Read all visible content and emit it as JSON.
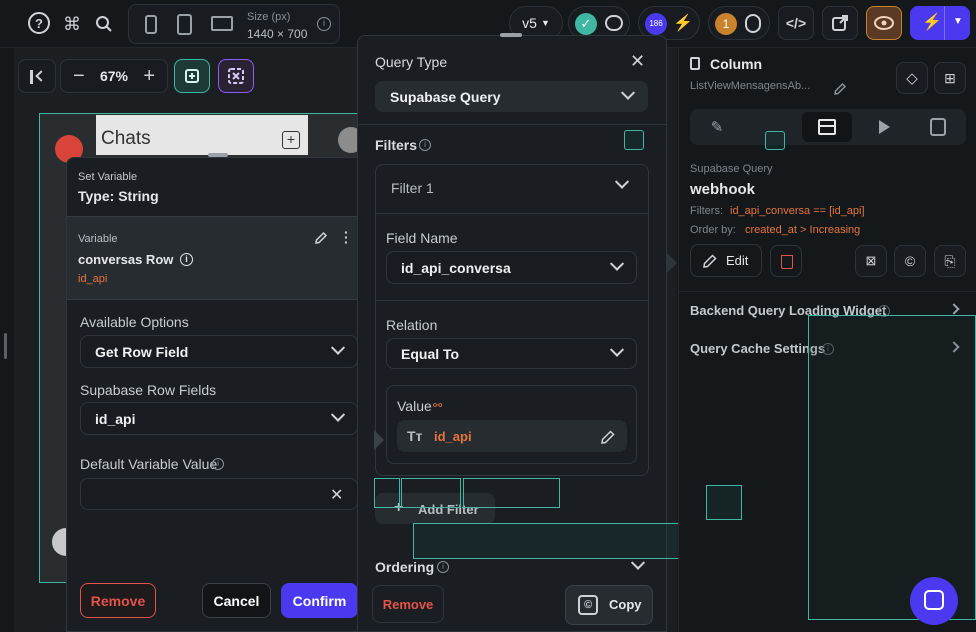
{
  "topbar": {
    "size_label": "Size (px)",
    "size_value": "1440 × 700",
    "version": "v5",
    "badge_count": "186",
    "bug_count": "1"
  },
  "canvas_toolbar": {
    "zoom": "67%"
  },
  "phone": {
    "title": "Chats"
  },
  "set_variable": {
    "heading": "Set Variable",
    "type": "Type: String",
    "variable_label": "Variable",
    "variable_name": "conversas Row",
    "variable_sub": "id_api",
    "available_options_label": "Available Options",
    "available_options_value": "Get Row Field",
    "row_fields_label": "Supabase Row Fields",
    "row_fields_value": "id_api",
    "default_value_label": "Default Variable Value",
    "remove_label": "Remove",
    "cancel_label": "Cancel",
    "confirm_label": "Confirm"
  },
  "query_panel": {
    "query_type_label": "Query Type",
    "query_type_value": "Supabase Query",
    "filters_label": "Filters",
    "filter_title": "Filter 1",
    "field_name_label": "Field Name",
    "field_name_value": "id_api_conversa",
    "relation_label": "Relation",
    "relation_value": "Equal To",
    "value_label": "Value",
    "value_value": "id_api",
    "add_filter_label": "Add Filter",
    "ordering_label": "Ordering",
    "remove_label": "Remove",
    "copy_label": "Copy"
  },
  "right_panel": {
    "widget_name": "Column",
    "widget_path": "ListViewMensagensAb...",
    "query_kind": "Supabase Query",
    "query_name": "webhook",
    "filters_label": "Filters:",
    "filters_value": "id_api_conversa == [id_api]",
    "order_label": "Order by:",
    "order_value": "created_at > Increasing",
    "edit_label": "Edit",
    "loading_widget_label": "Backend Query Loading Widget",
    "cache_label": "Query Cache Settings"
  },
  "colors": {
    "accent": "#4b39ef",
    "teal": "#3fb7a3",
    "danger": "#e2534a",
    "orange": "#e6743d"
  }
}
